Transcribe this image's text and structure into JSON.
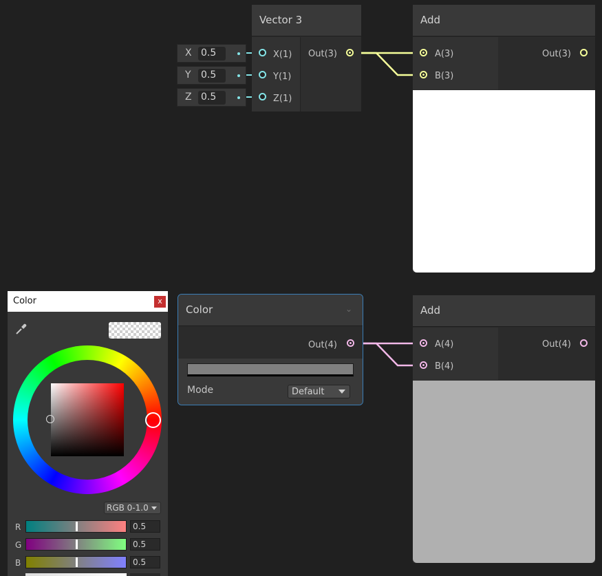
{
  "vector3_node": {
    "title": "Vector 3",
    "inputs": [
      {
        "label": "X(1)",
        "field_label": "X",
        "value": "0.5"
      },
      {
        "label": "Y(1)",
        "field_label": "Y",
        "value": "0.5"
      },
      {
        "label": "Z(1)",
        "field_label": "Z",
        "value": "0.5"
      }
    ],
    "output": "Out(3)"
  },
  "add_node_top": {
    "title": "Add",
    "inputs": [
      "A(3)",
      "B(3)"
    ],
    "output": "Out(3)",
    "preview_color": "#ffffff"
  },
  "color_node": {
    "title": "Color",
    "output": "Out(4)",
    "swatch_color": "#808080",
    "mode_label": "Mode",
    "mode_value": "Default"
  },
  "add_node_bottom": {
    "title": "Add",
    "inputs": [
      "A(4)",
      "B(4)"
    ],
    "output": "Out(4)",
    "preview_color": "#b0b0b0"
  },
  "color_picker": {
    "title": "Color",
    "close_label": "x",
    "mode_dropdown": "RGB 0-1.0",
    "channels": [
      {
        "name": "R",
        "value": "0.5",
        "level": 0.5
      },
      {
        "name": "G",
        "value": "0.5",
        "level": 0.5
      },
      {
        "name": "B",
        "value": "0.5",
        "level": 0.5
      }
    ]
  },
  "colors": {
    "vector3_wire": "#f6ff9a",
    "vector1_wire": "#84e4e7",
    "vector4_wire": "#f2b8e8",
    "selection_border": "#3c7fb8"
  }
}
